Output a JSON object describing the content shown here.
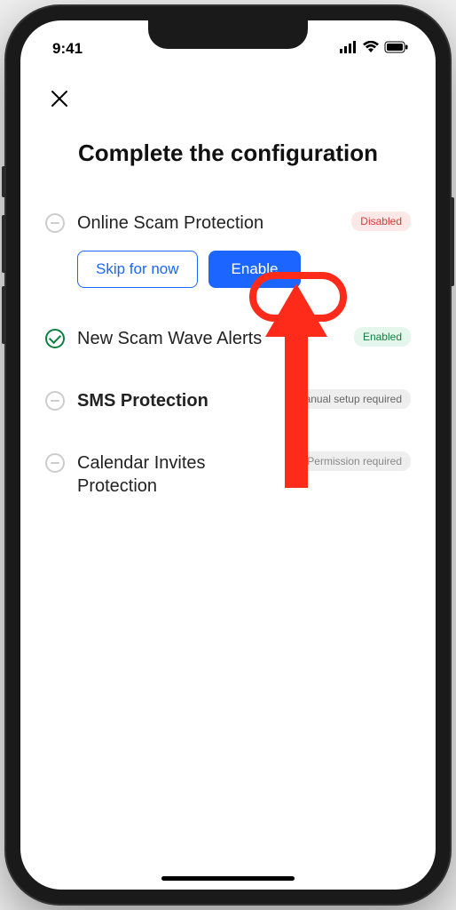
{
  "statusBar": {
    "time": "9:41"
  },
  "page": {
    "title": "Complete the configuration"
  },
  "items": [
    {
      "title": "Online Scam Protection",
      "badge": "Disabled",
      "skipLabel": "Skip for now",
      "enableLabel": "Enable"
    },
    {
      "title": "New Scam Wave Alerts",
      "badge": "Enabled"
    },
    {
      "title": "SMS Protection",
      "badge": "Manual setup required"
    },
    {
      "title": "Calendar Invites Protection",
      "badge": "Permission required"
    }
  ]
}
